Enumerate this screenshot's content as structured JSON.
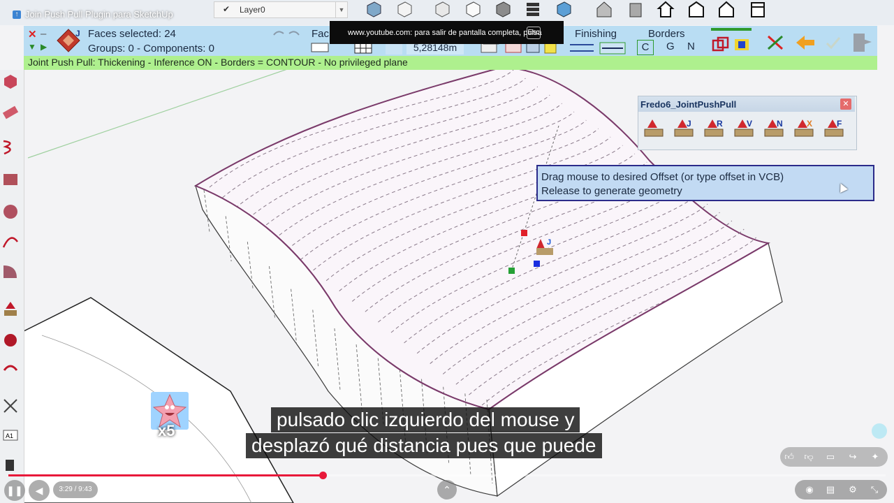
{
  "video": {
    "title": "Join Push Pull Plugin para SketchUp",
    "fullscreen_notice": "www.youtube.com: para salir de pantalla completa, pulsa",
    "esc_key": "Esc",
    "time": "3:29 / 9:43",
    "progress": 0.358,
    "captions": [
      "pulsado clic izquierdo del mouse y",
      "desplazó qué distancia pues que puede"
    ],
    "badge": "x5"
  },
  "sketchup": {
    "layer": "Layer0",
    "layer_checked": true
  },
  "jpp_palette": {
    "faces_selected": "Faces selected: 24",
    "groups_components": "Groups: 0 - Components: 0",
    "menu_fac": "Fac",
    "offset_value": "5,28148m",
    "finishing_label": "Finishing",
    "borders_label": "Borders",
    "cgn": [
      "C",
      "G",
      "N"
    ],
    "status": "Joint Push Pull: Thickening - Inference ON - Borders = CONTOUR - No privileged plane"
  },
  "fredo_toolbar": {
    "title": "Fredo6_JointPushPull",
    "letters": [
      "",
      "J",
      "R",
      "V",
      "N",
      "X",
      "F"
    ]
  },
  "tooltip": {
    "line1": "Drag mouse to desired Offset (or type offset in VCB)",
    "line2": "Release to generate geometry"
  },
  "colors": {
    "palette_blue": "#b9ddf3",
    "status_green": "#aef08e",
    "edge_purple": "#7a3a6a",
    "progress_red": "#e8193a"
  }
}
